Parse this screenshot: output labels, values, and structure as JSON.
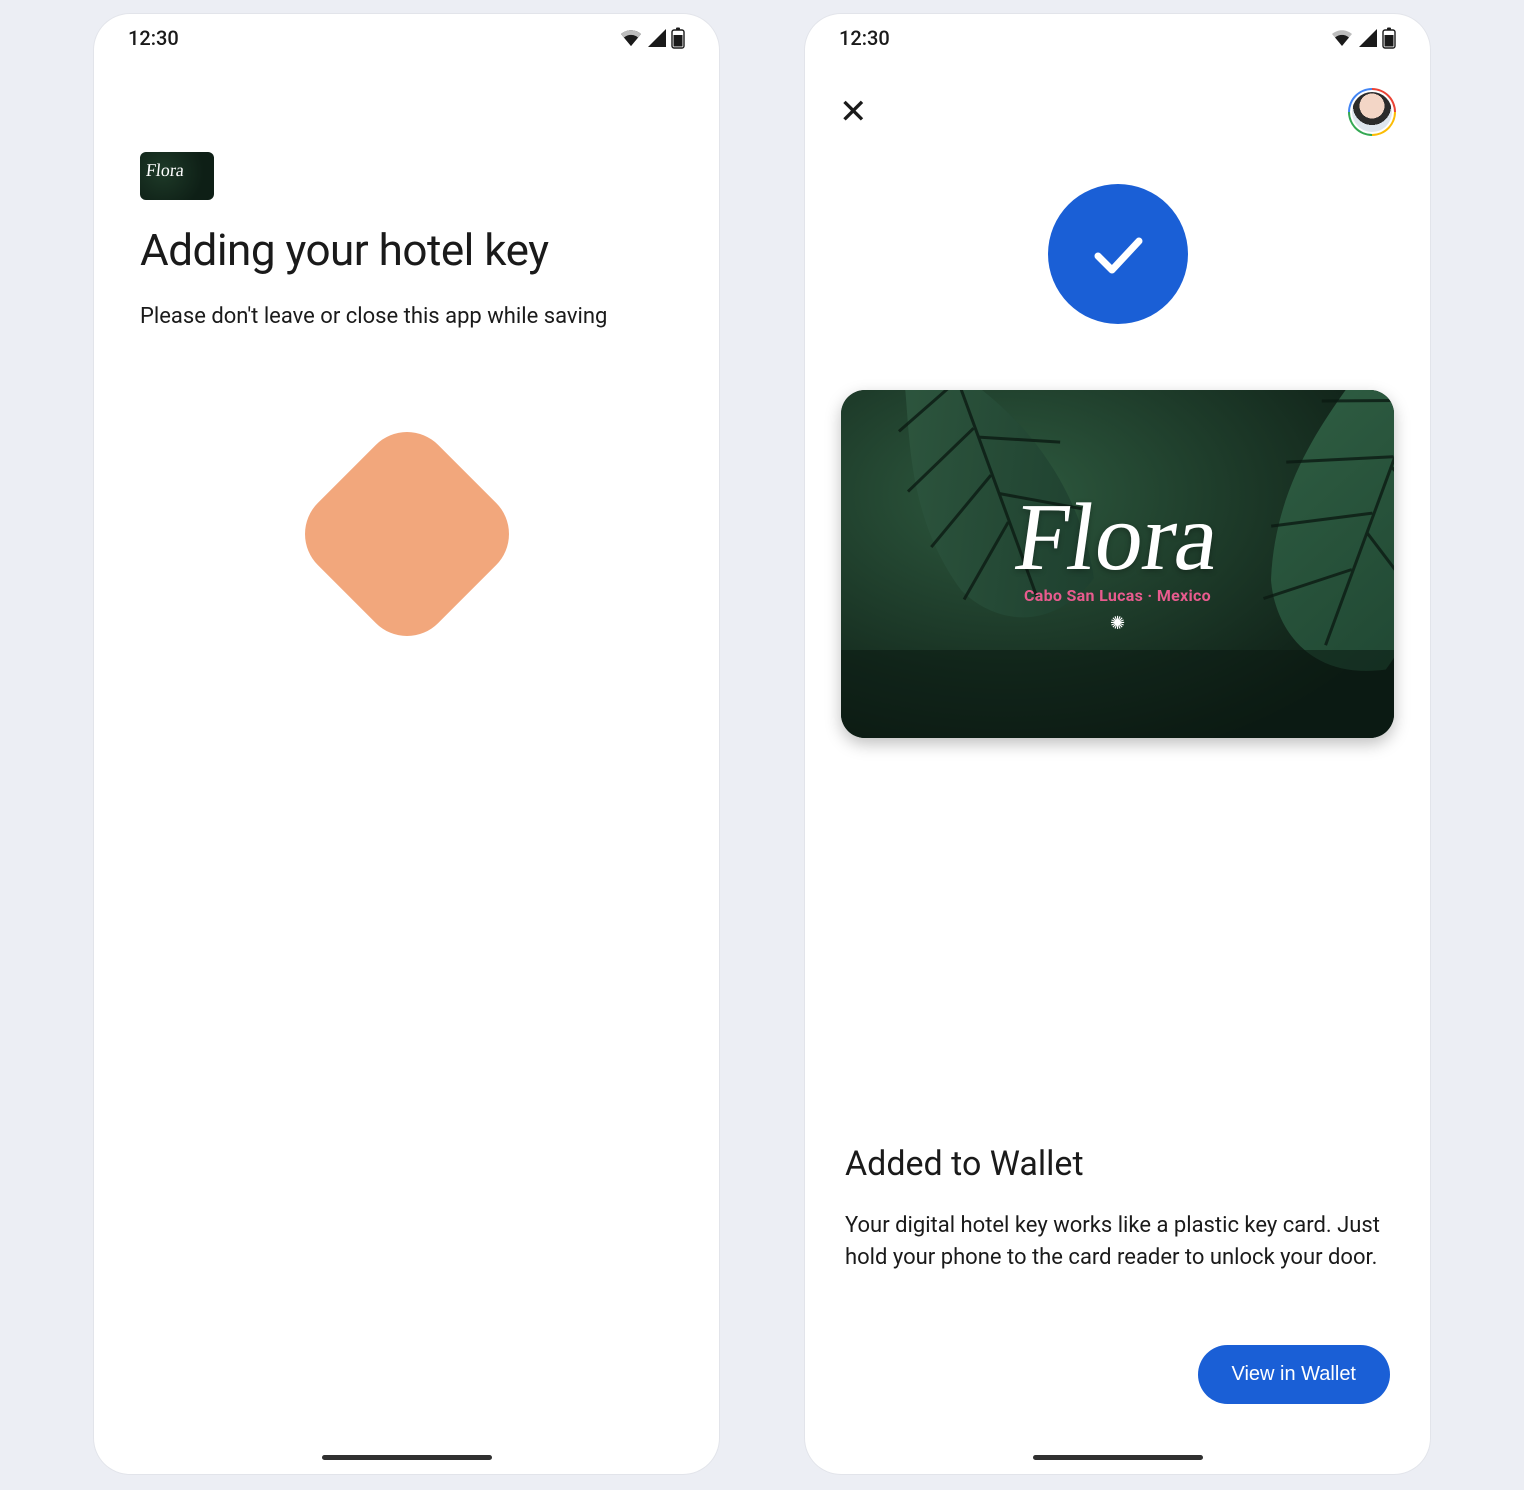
{
  "statusbar": {
    "time": "12:30"
  },
  "screen1": {
    "card_brand": "Flora",
    "title": "Adding your hotel key",
    "subtitle": "Please don't leave or close this app while saving"
  },
  "screen2": {
    "card": {
      "brand": "Flora",
      "location": "Cabo San Lucas · Mexico"
    },
    "added_title": "Added to Wallet",
    "added_desc": "Your digital hotel key works like a plastic key card. Just hold your phone to the card reader to unlock your door.",
    "view_button": "View in Wallet"
  }
}
